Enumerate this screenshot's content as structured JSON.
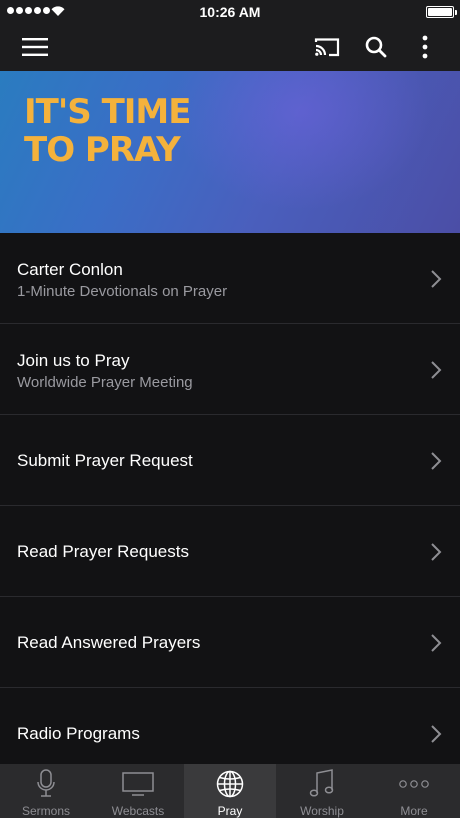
{
  "status_bar": {
    "time": "10:26 AM"
  },
  "banner": {
    "title": "IT'S TIME TO PRAY"
  },
  "list": [
    {
      "title": "Carter Conlon",
      "subtitle": "1-Minute Devotionals on Prayer"
    },
    {
      "title": "Join us to Pray",
      "subtitle": "Worldwide Prayer Meeting"
    },
    {
      "title": "Submit Prayer Request"
    },
    {
      "title": "Read Prayer Requests"
    },
    {
      "title": "Read Answered Prayers"
    },
    {
      "title": "Radio Programs"
    }
  ],
  "tabs": [
    {
      "label": "Sermons",
      "icon": "microphone-icon"
    },
    {
      "label": "Webcasts",
      "icon": "monitor-icon"
    },
    {
      "label": "Pray",
      "icon": "globe-icon",
      "active": true
    },
    {
      "label": "Worship",
      "icon": "music-note-icon"
    },
    {
      "label": "More",
      "icon": "ellipsis-icon"
    }
  ],
  "colors": {
    "accent": "#f4b23c",
    "background": "#121214",
    "bar": "#1c1c1e"
  }
}
